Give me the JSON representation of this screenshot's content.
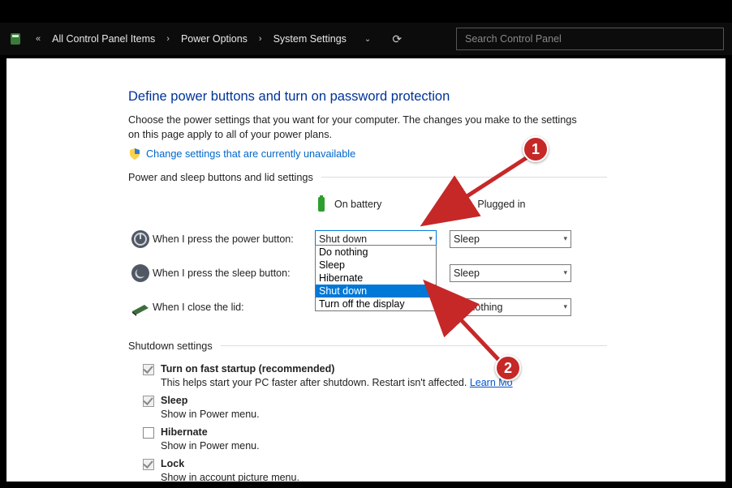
{
  "nav": {
    "breadcrumb_glyph": "«",
    "crumb1": "All Control Panel Items",
    "crumb2": "Power Options",
    "crumb3": "System Settings",
    "search_placeholder": "Search Control Panel"
  },
  "main": {
    "heading": "Define power buttons and turn on password protection",
    "desc": "Choose the power settings that you want for your computer. The changes you make to the settings on this page apply to all of your power plans.",
    "change_link": "Change settings that are currently unavailable",
    "section1": "Power and sleep buttons and lid settings",
    "col_battery": "On battery",
    "col_plugged": "Plugged in",
    "row_power": "When I press the power button:",
    "row_sleep": "When I press the sleep button:",
    "row_lid": "When I close the lid:",
    "dd_power_batt": "Shut down",
    "dd_power_plug": "Sleep",
    "dd_sleep_plug": "Sleep",
    "dd_lid_plug": "Do nothing",
    "dd_options": [
      "Do nothing",
      "Sleep",
      "Hibernate",
      "Shut down",
      "Turn off the display"
    ],
    "dd_selected_index": 3,
    "section2": "Shutdown settings",
    "chk_fast_label": "Turn on fast startup (recommended)",
    "chk_fast_sub_a": "This helps start your PC faster after shutdown. Restart isn't affected. ",
    "chk_fast_sub_link": "Learn Mo",
    "chk_sleep_label": "Sleep",
    "chk_sleep_sub": "Show in Power menu.",
    "chk_hib_label": "Hibernate",
    "chk_hib_sub": "Show in Power menu.",
    "chk_lock_label": "Lock",
    "chk_lock_sub": "Show in account picture menu."
  },
  "annotations": {
    "c1": "1",
    "c2": "2"
  }
}
